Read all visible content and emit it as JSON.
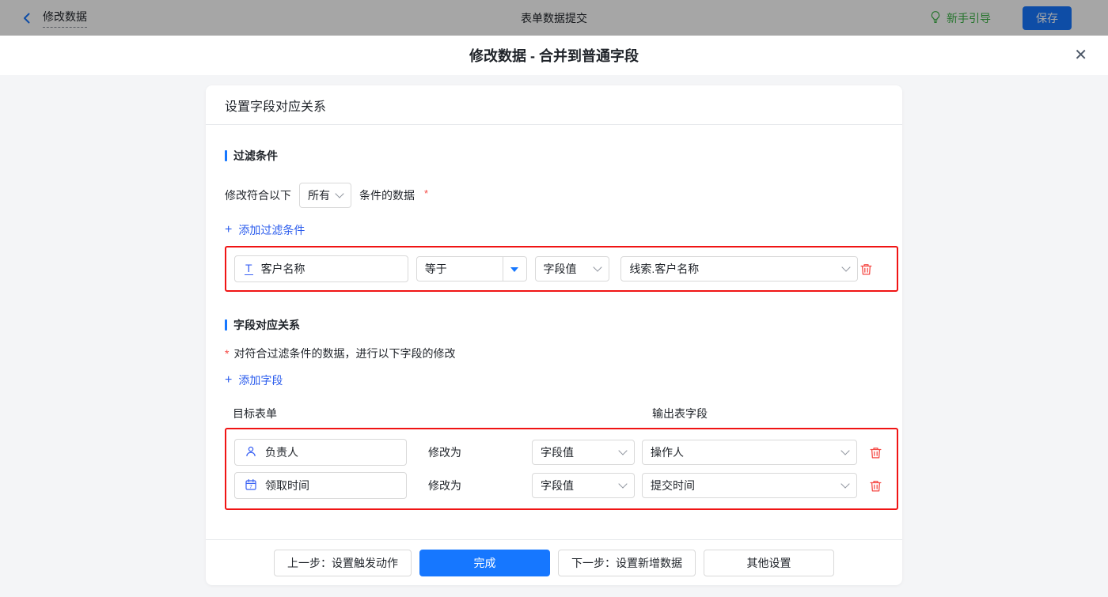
{
  "colors": {
    "primary_blue": "#1677ff",
    "link_blue": "#2b5ced",
    "icon_blue": "#3860f4",
    "highlight_red": "#f01414",
    "danger_red": "#f54a45",
    "success_green": "#3bb346",
    "topbar_dim_gray": "#ababab"
  },
  "topbar": {
    "back_label": "修改数据",
    "center_title": "表单数据提交",
    "guide_label": "新手引导",
    "save_label": "保存"
  },
  "modal": {
    "title": "修改数据 - 合并到普通字段",
    "close_glyph": "✕",
    "card_header": "设置字段对应关系",
    "filter": {
      "section_title": "过滤条件",
      "condition_prefix": "修改符合以下",
      "match_value": "所有",
      "condition_suffix": "条件的数据",
      "required_mark": "*",
      "add_icon": "+",
      "add_label": "添加过滤条件",
      "rows": [
        {
          "field": "客户名称",
          "operator": "等于",
          "value_type": "字段值",
          "value": "线索.客户名称"
        }
      ]
    },
    "mapping": {
      "section_title": "字段对应关系",
      "required_mark": "*",
      "description": "对符合过滤条件的数据，进行以下字段的修改",
      "add_icon": "+",
      "add_label": "添加字段",
      "column_left": "目标表单",
      "column_right": "输出表字段",
      "rows": [
        {
          "field": "负责人",
          "action": "修改为",
          "value_type": "字段值",
          "value": "操作人"
        },
        {
          "field": "领取时间",
          "action": "修改为",
          "value_type": "字段值",
          "value": "提交时间"
        }
      ]
    },
    "footer": {
      "prev_label": "上一步：设置触发动作",
      "done_label": "完成",
      "next_label": "下一步：设置新增数据",
      "other_label": "其他设置"
    }
  }
}
